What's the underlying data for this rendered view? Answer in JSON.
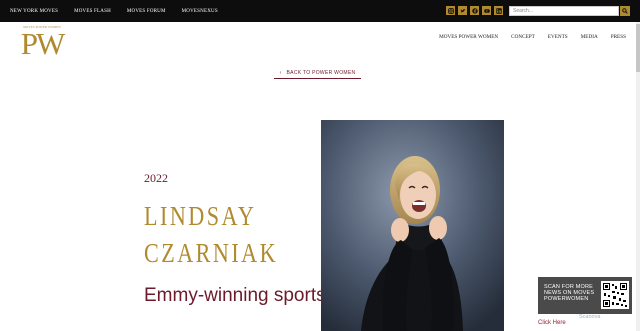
{
  "topnav": {
    "items": [
      "NEW YORK MOVES",
      "MOVES FLASH",
      "MOVES FORUM",
      "MOVESNEXUS"
    ]
  },
  "socials": [
    "instagram-icon",
    "twitter-icon",
    "facebook-icon",
    "youtube-icon",
    "linkedin-icon"
  ],
  "search": {
    "placeholder": "Search..."
  },
  "logo": {
    "tagline": "MOVES POWER WOMEN",
    "monogram": "PW"
  },
  "mainnav": {
    "items": [
      "MOVES POWER WOMEN",
      "CONCEPT",
      "EVENTS",
      "MEDIA",
      "PRESS"
    ]
  },
  "back_link": {
    "label": "BACK TO POWER WOMEN"
  },
  "profile": {
    "year": "2022",
    "first_name": "LINDSAY",
    "last_name": "CZARNIAK",
    "role": "Emmy-winning sportscaster"
  },
  "qr_widget": {
    "text": "SCAN FOR MORE NEWS ON MOVES POWERWOMEN",
    "brand": "Scanova",
    "cta": "Click Here"
  },
  "colors": {
    "gold": "#b08a2e",
    "maroon": "#6b1a2b",
    "topbar": "#0d0d0d"
  }
}
